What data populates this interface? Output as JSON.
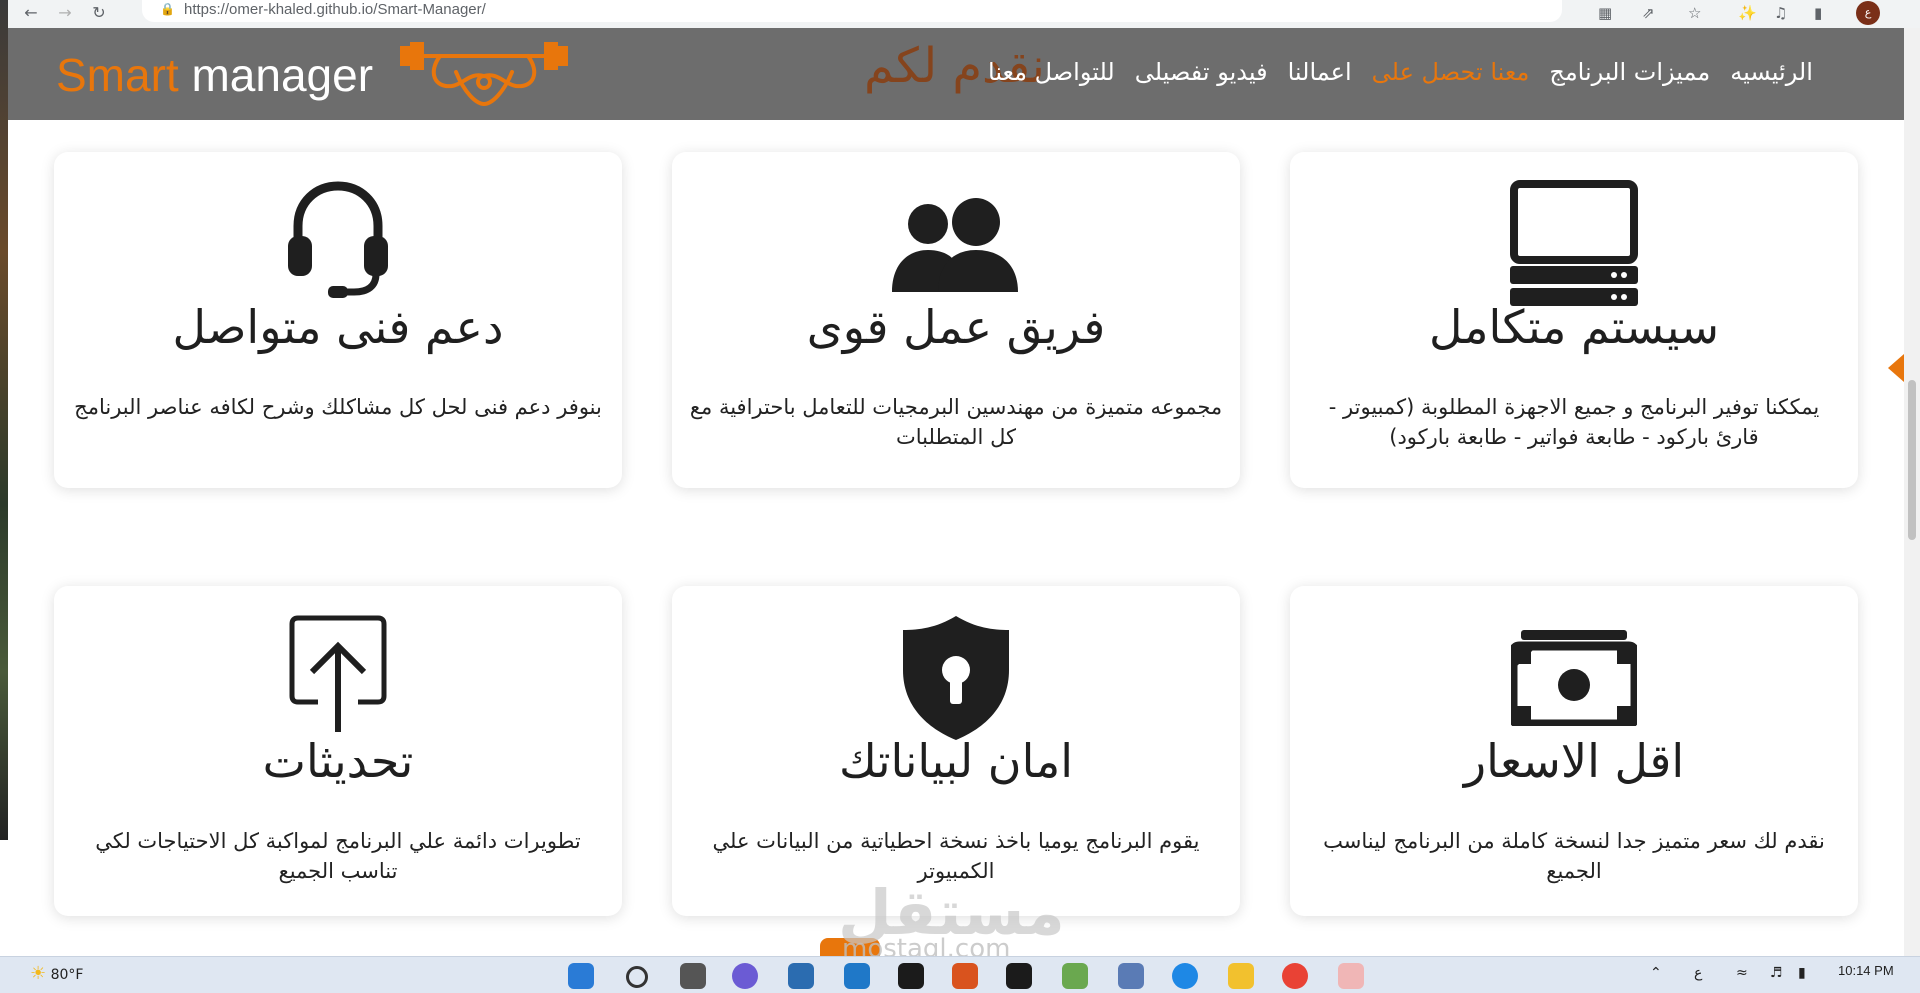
{
  "browser": {
    "url": "https://omer-khaled.github.io/Smart-Manager/"
  },
  "header": {
    "brand_part1": "Smart",
    "brand_part2": " manager",
    "overlay_title": "نقدم لكم",
    "nav": [
      {
        "label": "الرئيسيه"
      },
      {
        "label": "مميزات البرنامج"
      },
      {
        "label": "معنا تحصل على"
      },
      {
        "label": "اعمالنا"
      },
      {
        "label": "فيديو تفصيلى"
      },
      {
        "label": "للتواصل معنا"
      }
    ],
    "active_nav": "معنا تحصل على",
    "accent_color": "#e8760c",
    "header_bg": "#6d6d6d"
  },
  "features": [
    {
      "icon": "computer-icon",
      "title": "سيستم متكامل",
      "text": "يمككنا توفير البرنامج و جميع الاجهزة المطلوبة (كمبيوتر - قارئ باركود - طابعة فواتير - طابعة باركود)"
    },
    {
      "icon": "users-icon",
      "title": "فريق عمل قوى",
      "text": "مجموعه متميزة من مهندسين البرمجيات للتعامل باحترافية مع كل المتطلبات"
    },
    {
      "icon": "headset-icon",
      "title": "دعم فنى متواصل",
      "text": "بنوفر دعم فنى لحل كل مشاكلك وشرح لكافه عناصر البرنامج"
    },
    {
      "icon": "money-icon",
      "title": "اقل الاسعار",
      "text": "نقدم لك سعر متميز جدا لنسخة كاملة من البرنامج ليناسب الجميع"
    },
    {
      "icon": "shield-lock-icon",
      "title": "امان لبياناتك",
      "text": "يقوم البرنامج يوميا باخذ نسخة احطياتية من البيانات علي الكمبيوتر"
    },
    {
      "icon": "upload-icon",
      "title": "تحديثات",
      "text": "تطويرات دائمة علي البرنامج لمواكبة كل الاحتياجات لكي تناسب الجميع"
    }
  ],
  "watermark": {
    "line1": "مستقل",
    "line2": "mostaql.com"
  },
  "taskbar": {
    "temperature": "80°F",
    "time": "10:14 PM"
  }
}
